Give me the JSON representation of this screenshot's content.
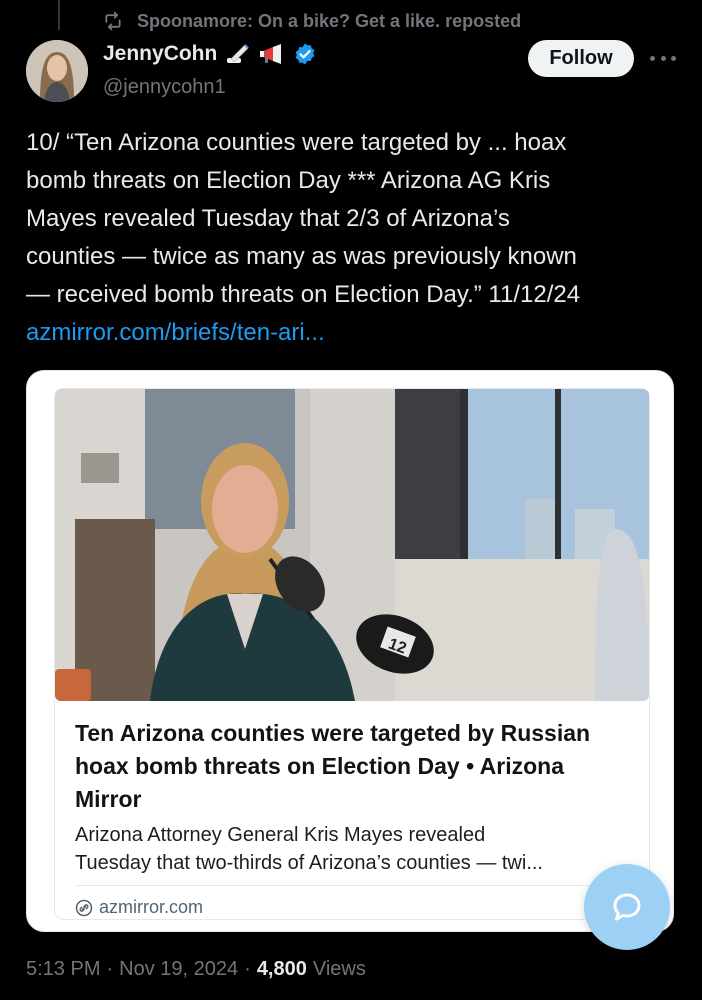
{
  "repost": {
    "text": "Spoonamore: On a bike? Get a like. reposted",
    "icon": "repost-icon"
  },
  "author": {
    "display_name": "JennyCohn",
    "handle": "@jennycohn1",
    "emoji_icons": [
      "writing-hand-icon",
      "megaphone-icon"
    ],
    "verified_icon": "verified-badge-icon"
  },
  "actions": {
    "follow_label": "Follow",
    "more_icon": "more-icon"
  },
  "tweet": {
    "lines": [
      "10/ “Ten Arizona counties were targeted by ... hoax",
      "bomb threats on Election Day *** Arizona AG Kris",
      "Mayes revealed Tuesday that 2/3 of Arizona’s",
      "counties — twice as many as was previously known",
      "— received bomb threats on Election Day.” 11/12/24"
    ],
    "link": "azmirror.com/briefs/ten-ari..."
  },
  "card": {
    "title": "Ten Arizona counties were targeted by Russian hoax bomb threats on Election Day • Arizona Mirror",
    "description_lines": [
      "Arizona Attorney General Kris Mayes revealed",
      "Tuesday that two-thirds of Arizona’s counties — twi..."
    ],
    "domain": "azmirror.com",
    "image_badge": "12"
  },
  "meta": {
    "time": "5:13 PM",
    "sep1": "·",
    "date": "Nov 19, 2024",
    "sep2": "·",
    "views_count": "4,800",
    "views_label": "Views"
  },
  "colors": {
    "background": "#000000",
    "link": "#1d9bf0",
    "muted": "#71767b",
    "fab": "#9cd0f5"
  }
}
